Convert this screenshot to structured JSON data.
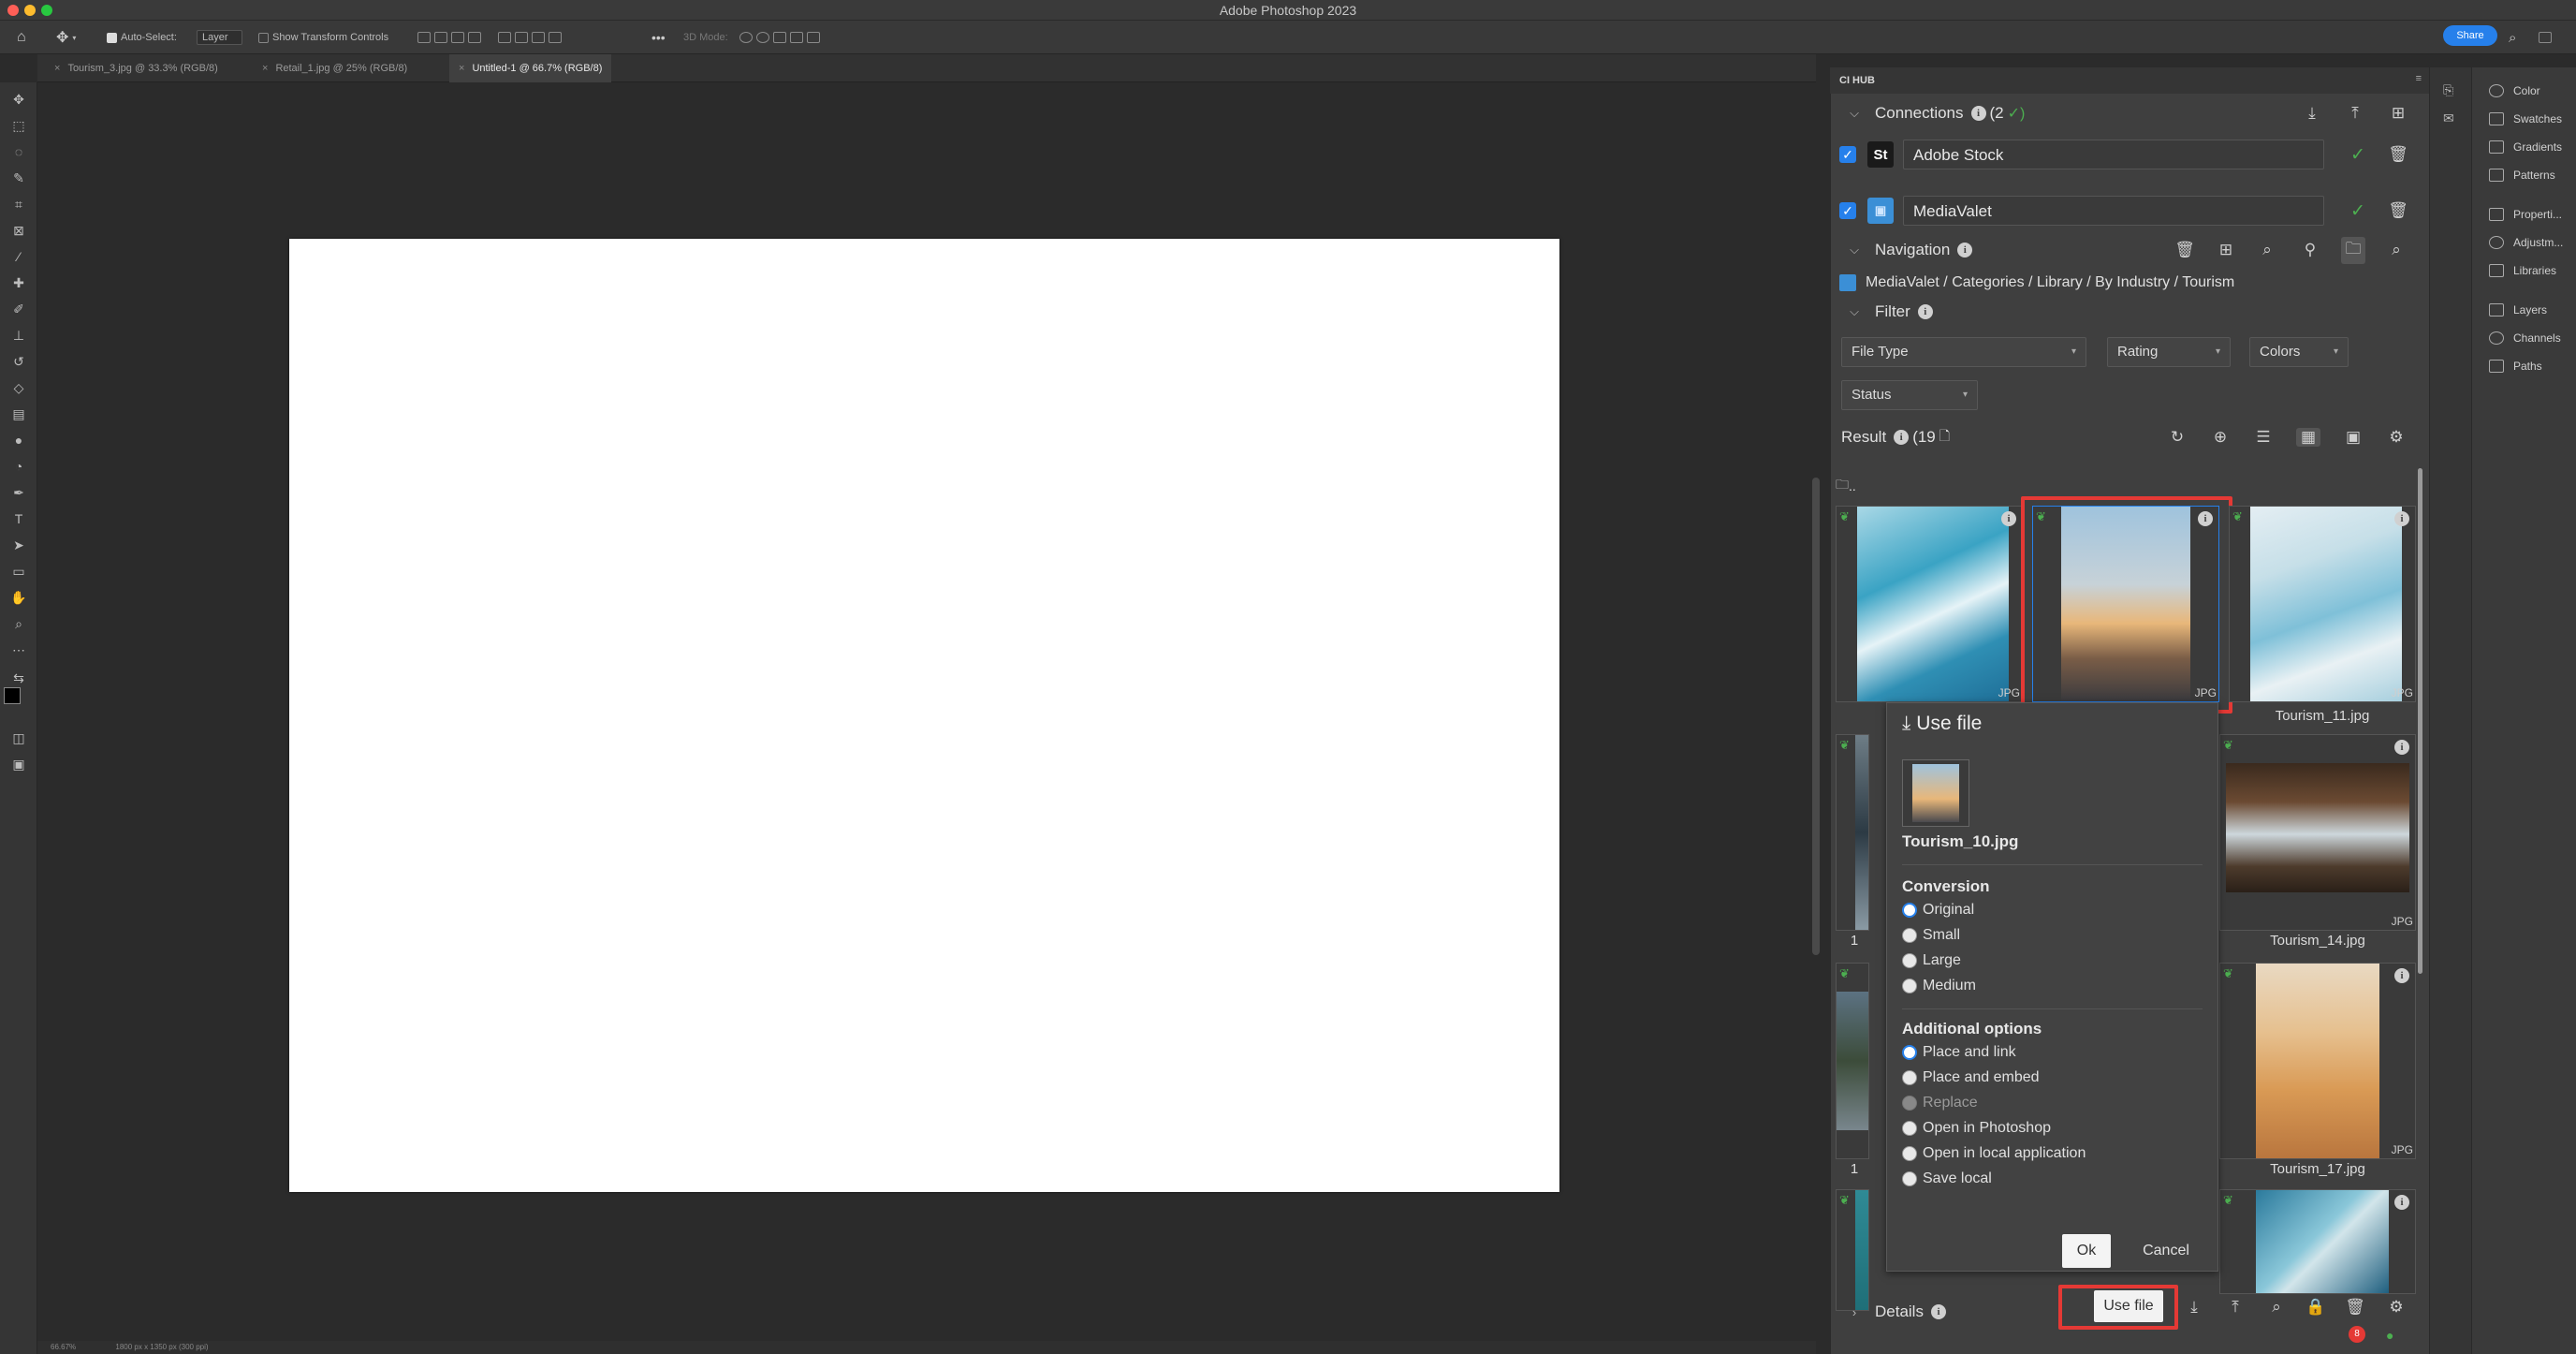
{
  "app": {
    "title": "Adobe Photoshop 2023"
  },
  "options_bar": {
    "auto_select_label": "Auto-Select:",
    "auto_select_value": "Layer",
    "show_transform_label": "Show Transform Controls",
    "mode_3d_label": "3D Mode:",
    "share_label": "Share"
  },
  "tabs": [
    {
      "label": "Tourism_3.jpg @ 33.3% (RGB/8)"
    },
    {
      "label": "Retail_1.jpg @ 25% (RGB/8)"
    },
    {
      "label": "Untitled-1 @ 66.7% (RGB/8)"
    }
  ],
  "status_bar": {
    "zoom": "66.67%",
    "doc_info": "1800 px x 1350 px (300 ppi)"
  },
  "hub": {
    "title": "CI HUB",
    "connections": {
      "label": "Connections",
      "count": "(2",
      "check": "✓)"
    },
    "services": [
      {
        "logo": "St",
        "name": "Adobe Stock",
        "logo_bg": "#1a1a1a"
      },
      {
        "logo": "▣",
        "name": "MediaValet",
        "logo_bg": "#3b8fd6"
      }
    ],
    "navigation": {
      "label": "Navigation"
    },
    "breadcrumb": "MediaValet / Categories / Library / By Industry / Tourism",
    "filter": {
      "label": "Filter"
    },
    "filters": [
      "File Type",
      "Rating",
      "Colors",
      "Status"
    ],
    "result": {
      "label": "Result",
      "count": "(19"
    },
    "folder_up": "..",
    "grid": [
      {
        "name": "",
        "ext": "JPG"
      },
      {
        "name": "",
        "ext": "JPG"
      },
      {
        "name": "Tourism_11.jpg",
        "ext": "JPG"
      },
      {
        "name": "Tourism_14.jpg",
        "ext": "JPG"
      },
      {
        "name": "Tourism_17.jpg",
        "ext": "JPG"
      },
      {
        "name": "",
        "ext": ""
      }
    ],
    "side_labels": [
      "1",
      "1",
      "1"
    ],
    "details": {
      "label": "Details"
    },
    "use_file_button": "Use file",
    "badge_count": "8"
  },
  "use_file_popup": {
    "title": "Use file",
    "file_name": "Tourism_10.jpg",
    "conversion_label": "Conversion",
    "conversion_options": [
      {
        "label": "Original",
        "state": "on"
      },
      {
        "label": "Small",
        "state": "off"
      },
      {
        "label": "Large",
        "state": "off"
      },
      {
        "label": "Medium",
        "state": "off"
      }
    ],
    "additional_label": "Additional options",
    "additional_options": [
      {
        "label": "Place and link",
        "state": "on"
      },
      {
        "label": "Place and embed",
        "state": "off"
      },
      {
        "label": "Replace",
        "state": "disabled"
      },
      {
        "label": "Open in Photoshop",
        "state": "off"
      },
      {
        "label": "Open in local application",
        "state": "off"
      },
      {
        "label": "Save local",
        "state": "off"
      }
    ],
    "ok_label": "Ok",
    "cancel_label": "Cancel"
  },
  "right_panels": [
    {
      "label": "Color"
    },
    {
      "label": "Swatches"
    },
    {
      "label": "Gradients"
    },
    {
      "label": "Patterns"
    },
    {
      "label": "Properti..."
    },
    {
      "label": "Adjustm..."
    },
    {
      "label": "Libraries"
    },
    {
      "label": "Layers"
    },
    {
      "label": "Channels"
    },
    {
      "label": "Paths"
    }
  ],
  "colors": {
    "accent": "#2680eb",
    "highlight": "#e53935",
    "ok_green": "#4caf50"
  }
}
